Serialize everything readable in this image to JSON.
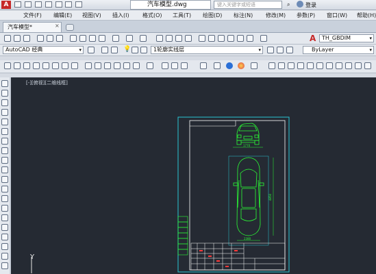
{
  "window": {
    "doc_title": "汽车模型.dwg",
    "search_placeholder": "键入关键字或短语",
    "login_label": "登录"
  },
  "menubar": {
    "items": [
      "文件(F)",
      "编辑(E)",
      "视图(V)",
      "插入(I)",
      "格式(O)",
      "工具(T)",
      "绘图(D)",
      "标注(N)",
      "修改(M)",
      "参数(P)",
      "窗口(W)",
      "帮助(H)"
    ]
  },
  "tabs": {
    "active": "汽车模型*"
  },
  "toolbars": {
    "dimstyle": "TH_GBDIM",
    "workspace": "AutoCAD 经典",
    "layer": "1轮廓实线层",
    "color": "ByLayer"
  },
  "viewport": {
    "label": "[-][俯视][二维线框]",
    "ucs_label": "Y"
  },
  "drawing": {
    "dim_top": "1770",
    "dim_side": "4850",
    "dim_bottom": "2380"
  },
  "colors": {
    "canvas": "#252a33",
    "frame": "#29c7d6",
    "car": "#2bff35",
    "table": "#ffffff"
  }
}
